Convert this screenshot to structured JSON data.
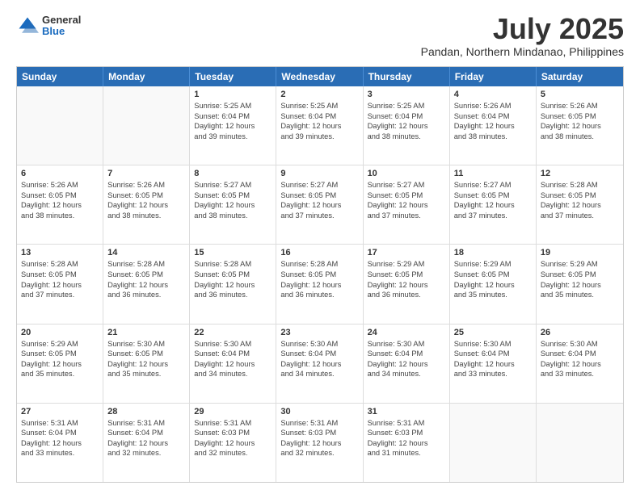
{
  "header": {
    "logo_general": "General",
    "logo_blue": "Blue",
    "month_year": "July 2025",
    "location": "Pandan, Northern Mindanao, Philippines"
  },
  "days_of_week": [
    "Sunday",
    "Monday",
    "Tuesday",
    "Wednesday",
    "Thursday",
    "Friday",
    "Saturday"
  ],
  "weeks": [
    [
      {
        "day": "",
        "sunrise": "",
        "sunset": "",
        "daylight": ""
      },
      {
        "day": "",
        "sunrise": "",
        "sunset": "",
        "daylight": ""
      },
      {
        "day": "1",
        "sunrise": "Sunrise: 5:25 AM",
        "sunset": "Sunset: 6:04 PM",
        "daylight": "Daylight: 12 hours and 39 minutes."
      },
      {
        "day": "2",
        "sunrise": "Sunrise: 5:25 AM",
        "sunset": "Sunset: 6:04 PM",
        "daylight": "Daylight: 12 hours and 39 minutes."
      },
      {
        "day": "3",
        "sunrise": "Sunrise: 5:25 AM",
        "sunset": "Sunset: 6:04 PM",
        "daylight": "Daylight: 12 hours and 38 minutes."
      },
      {
        "day": "4",
        "sunrise": "Sunrise: 5:26 AM",
        "sunset": "Sunset: 6:04 PM",
        "daylight": "Daylight: 12 hours and 38 minutes."
      },
      {
        "day": "5",
        "sunrise": "Sunrise: 5:26 AM",
        "sunset": "Sunset: 6:05 PM",
        "daylight": "Daylight: 12 hours and 38 minutes."
      }
    ],
    [
      {
        "day": "6",
        "sunrise": "Sunrise: 5:26 AM",
        "sunset": "Sunset: 6:05 PM",
        "daylight": "Daylight: 12 hours and 38 minutes."
      },
      {
        "day": "7",
        "sunrise": "Sunrise: 5:26 AM",
        "sunset": "Sunset: 6:05 PM",
        "daylight": "Daylight: 12 hours and 38 minutes."
      },
      {
        "day": "8",
        "sunrise": "Sunrise: 5:27 AM",
        "sunset": "Sunset: 6:05 PM",
        "daylight": "Daylight: 12 hours and 38 minutes."
      },
      {
        "day": "9",
        "sunrise": "Sunrise: 5:27 AM",
        "sunset": "Sunset: 6:05 PM",
        "daylight": "Daylight: 12 hours and 37 minutes."
      },
      {
        "day": "10",
        "sunrise": "Sunrise: 5:27 AM",
        "sunset": "Sunset: 6:05 PM",
        "daylight": "Daylight: 12 hours and 37 minutes."
      },
      {
        "day": "11",
        "sunrise": "Sunrise: 5:27 AM",
        "sunset": "Sunset: 6:05 PM",
        "daylight": "Daylight: 12 hours and 37 minutes."
      },
      {
        "day": "12",
        "sunrise": "Sunrise: 5:28 AM",
        "sunset": "Sunset: 6:05 PM",
        "daylight": "Daylight: 12 hours and 37 minutes."
      }
    ],
    [
      {
        "day": "13",
        "sunrise": "Sunrise: 5:28 AM",
        "sunset": "Sunset: 6:05 PM",
        "daylight": "Daylight: 12 hours and 37 minutes."
      },
      {
        "day": "14",
        "sunrise": "Sunrise: 5:28 AM",
        "sunset": "Sunset: 6:05 PM",
        "daylight": "Daylight: 12 hours and 36 minutes."
      },
      {
        "day": "15",
        "sunrise": "Sunrise: 5:28 AM",
        "sunset": "Sunset: 6:05 PM",
        "daylight": "Daylight: 12 hours and 36 minutes."
      },
      {
        "day": "16",
        "sunrise": "Sunrise: 5:28 AM",
        "sunset": "Sunset: 6:05 PM",
        "daylight": "Daylight: 12 hours and 36 minutes."
      },
      {
        "day": "17",
        "sunrise": "Sunrise: 5:29 AM",
        "sunset": "Sunset: 6:05 PM",
        "daylight": "Daylight: 12 hours and 36 minutes."
      },
      {
        "day": "18",
        "sunrise": "Sunrise: 5:29 AM",
        "sunset": "Sunset: 6:05 PM",
        "daylight": "Daylight: 12 hours and 35 minutes."
      },
      {
        "day": "19",
        "sunrise": "Sunrise: 5:29 AM",
        "sunset": "Sunset: 6:05 PM",
        "daylight": "Daylight: 12 hours and 35 minutes."
      }
    ],
    [
      {
        "day": "20",
        "sunrise": "Sunrise: 5:29 AM",
        "sunset": "Sunset: 6:05 PM",
        "daylight": "Daylight: 12 hours and 35 minutes."
      },
      {
        "day": "21",
        "sunrise": "Sunrise: 5:30 AM",
        "sunset": "Sunset: 6:05 PM",
        "daylight": "Daylight: 12 hours and 35 minutes."
      },
      {
        "day": "22",
        "sunrise": "Sunrise: 5:30 AM",
        "sunset": "Sunset: 6:04 PM",
        "daylight": "Daylight: 12 hours and 34 minutes."
      },
      {
        "day": "23",
        "sunrise": "Sunrise: 5:30 AM",
        "sunset": "Sunset: 6:04 PM",
        "daylight": "Daylight: 12 hours and 34 minutes."
      },
      {
        "day": "24",
        "sunrise": "Sunrise: 5:30 AM",
        "sunset": "Sunset: 6:04 PM",
        "daylight": "Daylight: 12 hours and 34 minutes."
      },
      {
        "day": "25",
        "sunrise": "Sunrise: 5:30 AM",
        "sunset": "Sunset: 6:04 PM",
        "daylight": "Daylight: 12 hours and 33 minutes."
      },
      {
        "day": "26",
        "sunrise": "Sunrise: 5:30 AM",
        "sunset": "Sunset: 6:04 PM",
        "daylight": "Daylight: 12 hours and 33 minutes."
      }
    ],
    [
      {
        "day": "27",
        "sunrise": "Sunrise: 5:31 AM",
        "sunset": "Sunset: 6:04 PM",
        "daylight": "Daylight: 12 hours and 33 minutes."
      },
      {
        "day": "28",
        "sunrise": "Sunrise: 5:31 AM",
        "sunset": "Sunset: 6:04 PM",
        "daylight": "Daylight: 12 hours and 32 minutes."
      },
      {
        "day": "29",
        "sunrise": "Sunrise: 5:31 AM",
        "sunset": "Sunset: 6:03 PM",
        "daylight": "Daylight: 12 hours and 32 minutes."
      },
      {
        "day": "30",
        "sunrise": "Sunrise: 5:31 AM",
        "sunset": "Sunset: 6:03 PM",
        "daylight": "Daylight: 12 hours and 32 minutes."
      },
      {
        "day": "31",
        "sunrise": "Sunrise: 5:31 AM",
        "sunset": "Sunset: 6:03 PM",
        "daylight": "Daylight: 12 hours and 31 minutes."
      },
      {
        "day": "",
        "sunrise": "",
        "sunset": "",
        "daylight": ""
      },
      {
        "day": "",
        "sunrise": "",
        "sunset": "",
        "daylight": ""
      }
    ]
  ]
}
